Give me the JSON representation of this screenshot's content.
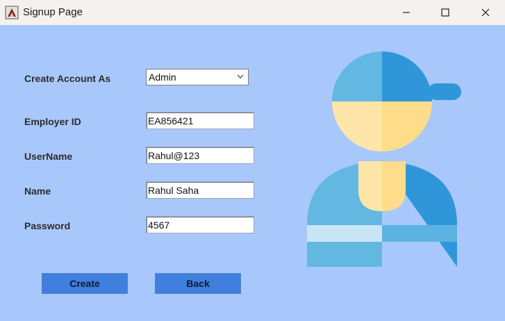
{
  "window": {
    "title": "Signup Page",
    "controls": {
      "minimize_icon": "minimize-icon",
      "maximize_icon": "maximize-icon",
      "close_icon": "close-icon"
    }
  },
  "form": {
    "account_type": {
      "label": "Create Account As",
      "selected": "Admin"
    },
    "employer_id": {
      "label": "Employer ID",
      "value": "EA856421"
    },
    "username": {
      "label": "UserName",
      "value": "Rahul@123"
    },
    "name": {
      "label": "Name",
      "value": "Rahul Saha"
    },
    "password": {
      "label": "Password",
      "value": "4567"
    }
  },
  "buttons": {
    "create": "Create",
    "back": "Back"
  },
  "colors": {
    "background": "#a8c8fb",
    "button": "#3f7fde",
    "titlebar": "#f6f1f1"
  },
  "illustration": "user-avatar-icon"
}
